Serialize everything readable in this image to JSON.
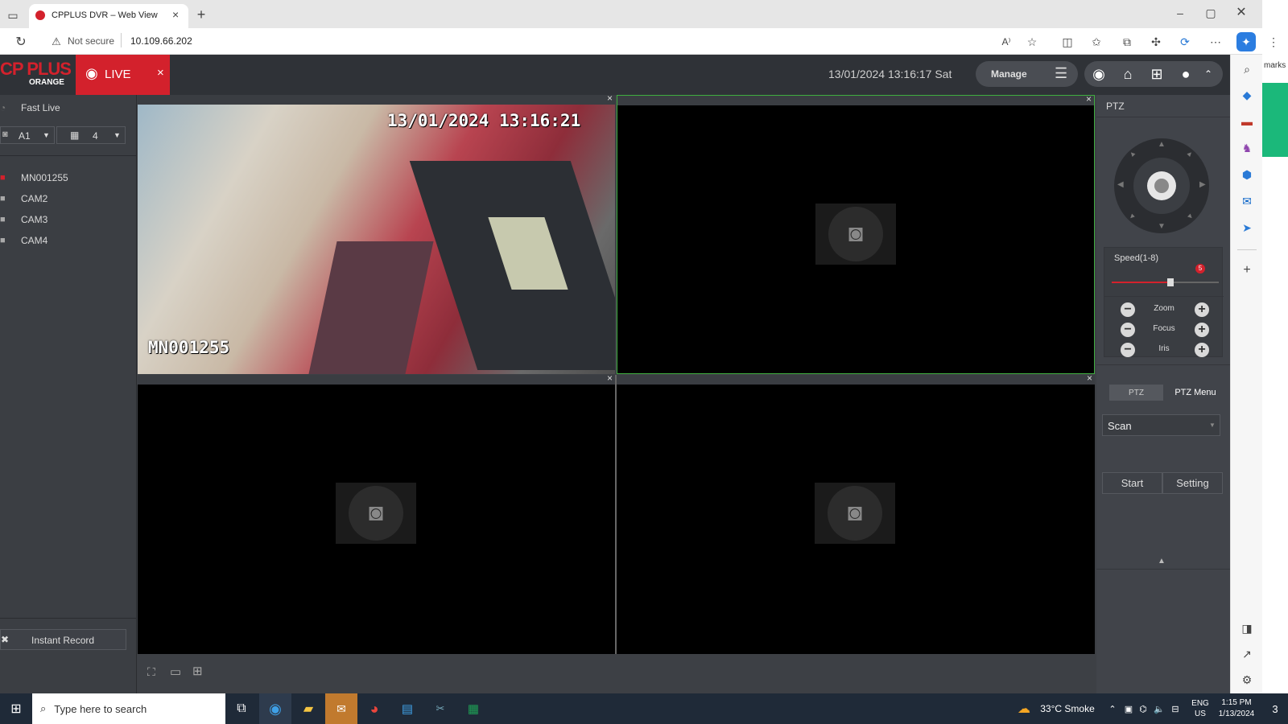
{
  "browser": {
    "tab_title": "CPPLUS DVR – Web View",
    "security_label": "Not secure",
    "url": "10.109.66.202",
    "side_text": "marks"
  },
  "header": {
    "logo_text": "CP PLUS",
    "logo_sub": "ORANGE",
    "live_label": "LIVE",
    "datetime": "13/01/2024 13:16:17 Sat",
    "manage_label": "Manage"
  },
  "sidebar": {
    "fast_live": "Fast Live",
    "channel_select": "A1",
    "layout_select": "4",
    "cameras": [
      "MN001255",
      "CAM2",
      "CAM3",
      "CAM4"
    ],
    "instant_record": "Instant Record"
  },
  "viewport1": {
    "osd_time": "13/01/2024 13:16:21",
    "osd_name": "MN001255"
  },
  "ptz": {
    "title": "PTZ",
    "speed_label": "Speed(1-8)",
    "speed_value": "5",
    "speed_fraction": 0.55,
    "zoom": "Zoom",
    "focus": "Focus",
    "iris": "Iris",
    "tab_ptz": "PTZ",
    "tab_menu": "PTZ Menu",
    "mode": "Scan",
    "start": "Start",
    "setting": "Setting"
  },
  "taskbar": {
    "search_placeholder": "Type here to search",
    "weather": "33°C  Smoke",
    "lang": "ENG",
    "region": "US",
    "time": "1:15 PM",
    "date": "1/13/2024",
    "notifications": "3"
  },
  "colors": {
    "accent_red": "#d3212c",
    "selected_border": "#3fae3f"
  }
}
